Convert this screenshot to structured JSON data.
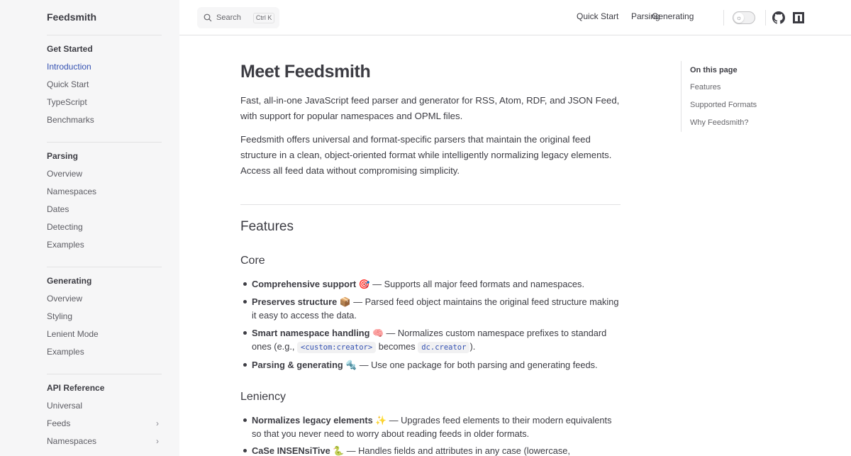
{
  "brand": "Feedsmith",
  "search": {
    "label": "Search",
    "shortcut": "Ctrl K"
  },
  "topnav": {
    "links": [
      "Quick Start",
      "Parsing",
      "Generating"
    ]
  },
  "sidebar": {
    "sections": [
      {
        "title": "Get Started",
        "items": [
          "Introduction",
          "Quick Start",
          "TypeScript",
          "Benchmarks"
        ]
      },
      {
        "title": "Parsing",
        "items": [
          "Overview",
          "Namespaces",
          "Dates",
          "Detecting",
          "Examples"
        ]
      },
      {
        "title": "Generating",
        "items": [
          "Overview",
          "Styling",
          "Lenient Mode",
          "Examples"
        ]
      },
      {
        "title": "API Reference",
        "items": [
          "Universal",
          "Feeds",
          "Namespaces"
        ]
      }
    ],
    "active_item": "Introduction"
  },
  "main": {
    "title": "Meet Feedsmith",
    "intro_1": "Fast, all-in-one JavaScript feed parser and generator for RSS, Atom, RDF, and JSON Feed, with support for popular namespaces and OPML files.",
    "intro_2": "Feedsmith offers universal and format-specific parsers that maintain the original feed structure in a clean, object-oriented format while intelligently normalizing legacy elements. Access all feed data without compromising simplicity.",
    "features_heading": "Features",
    "core_heading": "Core",
    "core": [
      {
        "title": "Comprehensive support",
        "emoji": "🎯",
        "desc": "— Supports all major feed formats and namespaces."
      },
      {
        "title": "Preserves structure",
        "emoji": "📦",
        "desc": "— Parsed feed object maintains the original feed structure making it easy to access the data."
      },
      {
        "title": "Smart namespace handling",
        "emoji": "🧠",
        "desc_before": "— Normalizes custom namespace prefixes to standard ones (e.g., ",
        "code_1": "<custom:creator>",
        "desc_middle": " becomes ",
        "code_2": "dc.creator",
        "desc_after": ")."
      },
      {
        "title": "Parsing & generating",
        "emoji": "🔩",
        "desc": "— Use one package for both parsing and generating feeds."
      }
    ],
    "leniency_heading": "Leniency",
    "leniency": [
      {
        "title": "Normalizes legacy elements",
        "emoji": "✨",
        "desc": "— Upgrades feed elements to their modern equivalents so that you never need to worry about reading feeds in older formats."
      },
      {
        "title": "CaSe INSENsiTive",
        "emoji": "🐍",
        "desc": "— Handles fields and attributes in any case (lowercase,"
      }
    ]
  },
  "outline": {
    "title": "On this page",
    "items": [
      "Features",
      "Supported Formats",
      "Why Feedsmith?"
    ]
  }
}
